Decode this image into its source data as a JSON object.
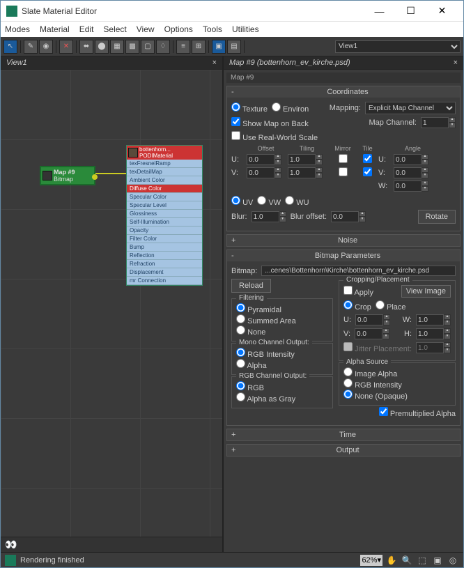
{
  "window": {
    "title": "Slate Material Editor"
  },
  "menu": {
    "items": [
      "Modes",
      "Material",
      "Edit",
      "Select",
      "View",
      "Options",
      "Tools",
      "Utilities"
    ]
  },
  "toolbar": {
    "view_dropdown": "View1"
  },
  "left": {
    "tab": "View1",
    "node_bitmap": {
      "line1": "Map #9",
      "line2": "Bitmap"
    },
    "node_mat": {
      "header": "bottenhorn...",
      "header2": "PODIMaterial",
      "slots": [
        "texFresnelRamp",
        "texDetailMap",
        "Ambient Color",
        "Diffuse Color",
        "Specular Color",
        "Specular Level",
        "Glossiness",
        "Self-Illumination",
        "Opacity",
        "Filter Color",
        "Bump",
        "Reflection",
        "Refraction",
        "Displacement",
        "mr Connection"
      ]
    }
  },
  "right": {
    "tab": "Map #9 (bottenhorn_ev_kirche.psd)",
    "breadcrumb": "Map #9",
    "coords": {
      "title": "Coordinates",
      "texture": "Texture",
      "environ": "Environ",
      "mapping_lbl": "Mapping:",
      "mapping_val": "Explicit Map Channel",
      "show_back": "Show Map on Back",
      "real_world": "Use Real-World Scale",
      "map_channel_lbl": "Map Channel:",
      "map_channel_val": "1",
      "hdr_offset": "Offset",
      "hdr_tiling": "Tiling",
      "hdr_mirror": "Mirror",
      "hdr_tile": "Tile",
      "hdr_angle": "Angle",
      "u_lbl": "U:",
      "v_lbl": "V:",
      "w_lbl": "W:",
      "u_off": "0.0",
      "u_til": "1.0",
      "u_ang": "0.0",
      "v_off": "0.0",
      "v_til": "1.0",
      "v_ang": "0.0",
      "w_ang": "0.0",
      "uv": "UV",
      "vw": "VW",
      "wu": "WU",
      "blur_lbl": "Blur:",
      "blur_val": "1.0",
      "blur_off_lbl": "Blur offset:",
      "blur_off_val": "0.0",
      "rotate": "Rotate"
    },
    "noise": {
      "title": "Noise"
    },
    "bparams": {
      "title": "Bitmap Parameters",
      "bitmap_lbl": "Bitmap:",
      "bitmap_path": "...cenes\\Bottenhorn\\Kirche\\bottenhorn_ev_kirche.psd",
      "reload": "Reload",
      "filtering": "Filtering",
      "pyramidal": "Pyramidal",
      "summed": "Summed Area",
      "none": "None",
      "mono": "Mono Channel Output:",
      "rgb_int": "RGB Intensity",
      "alpha": "Alpha",
      "rgbout": "RGB Channel Output:",
      "rgb": "RGB",
      "alpha_gray": "Alpha as Gray",
      "crop": {
        "title": "Cropping/Placement",
        "apply": "Apply",
        "view_image": "View Image",
        "crop": "Crop",
        "place": "Place",
        "u_lbl": "U:",
        "u_val": "0.0",
        "w_lbl": "W:",
        "w_val": "1.0",
        "v_lbl": "V:",
        "v_val": "0.0",
        "h_lbl": "H:",
        "h_val": "1.0",
        "jitter_lbl": "Jitter Placement:",
        "jitter_val": "1.0"
      },
      "alpha_src": {
        "title": "Alpha Source",
        "img_alpha": "Image Alpha",
        "rgb_int": "RGB Intensity",
        "none": "None (Opaque)",
        "premult": "Premultiplied Alpha"
      }
    },
    "time": {
      "title": "Time"
    },
    "output": {
      "title": "Output"
    }
  },
  "status": {
    "text": "Rendering finished",
    "zoom": "62%"
  }
}
